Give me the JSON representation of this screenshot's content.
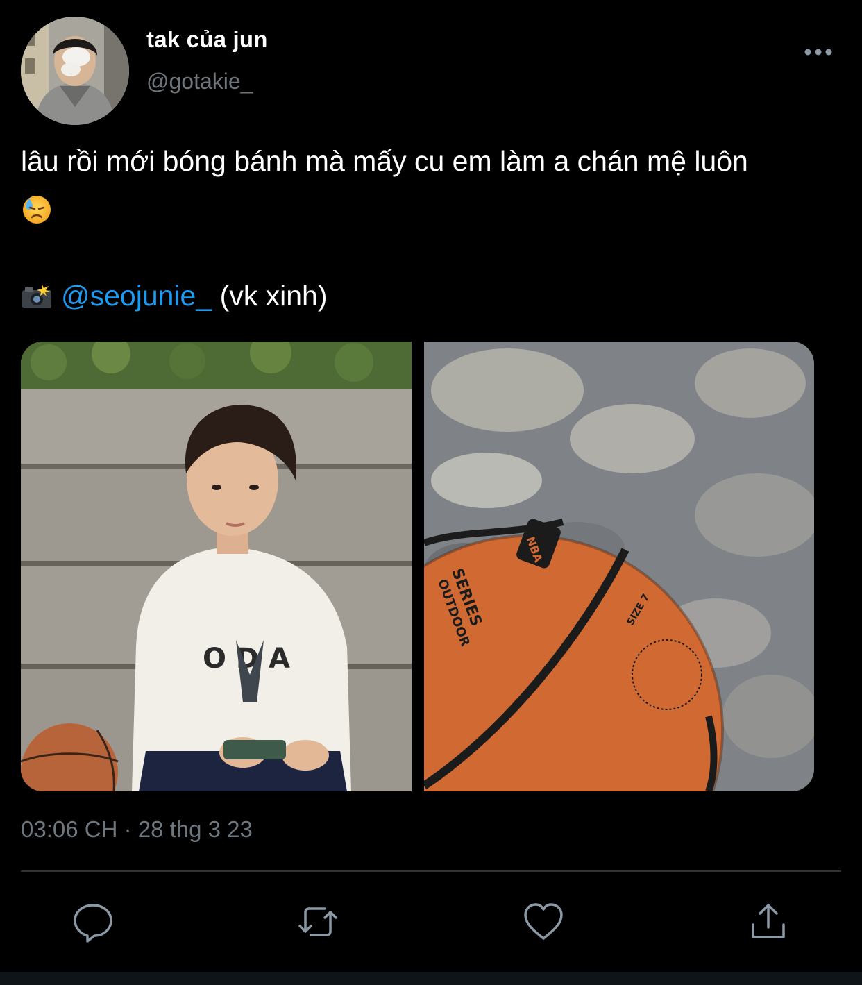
{
  "user": {
    "display_name": "tak của jun",
    "handle": "@gotakie_"
  },
  "tweet": {
    "text": "lâu rồi mới bóng bánh mà mấy cu em làm a chán mệ luôn",
    "emoji": "downcast-face-with-sweat-icon",
    "mention_prefix_icon": "camera-with-flash-icon",
    "mention": "@seojunie_",
    "mention_suffix": "(vk xinh)",
    "timestamp": "03:06 CH · 28 thg 3 23"
  },
  "photos": [
    {
      "subject": "person-sitting-on-steps-photo"
    },
    {
      "subject": "basketball-on-pavement-photo",
      "ball_text": [
        "NBA",
        "SERIES",
        "OUTDOOR",
        "SIZE 7"
      ]
    }
  ],
  "actions": [
    {
      "name": "reply",
      "icon": "reply-icon"
    },
    {
      "name": "retweet",
      "icon": "retweet-icon"
    },
    {
      "name": "like",
      "icon": "heart-icon"
    },
    {
      "name": "share",
      "icon": "share-icon"
    }
  ],
  "colors": {
    "background": "#000000",
    "primary_text": "#ffffff",
    "secondary_text": "#6e767d",
    "link": "#1d9bf0",
    "divider": "#2f3336",
    "icon": "#8b98a5"
  }
}
